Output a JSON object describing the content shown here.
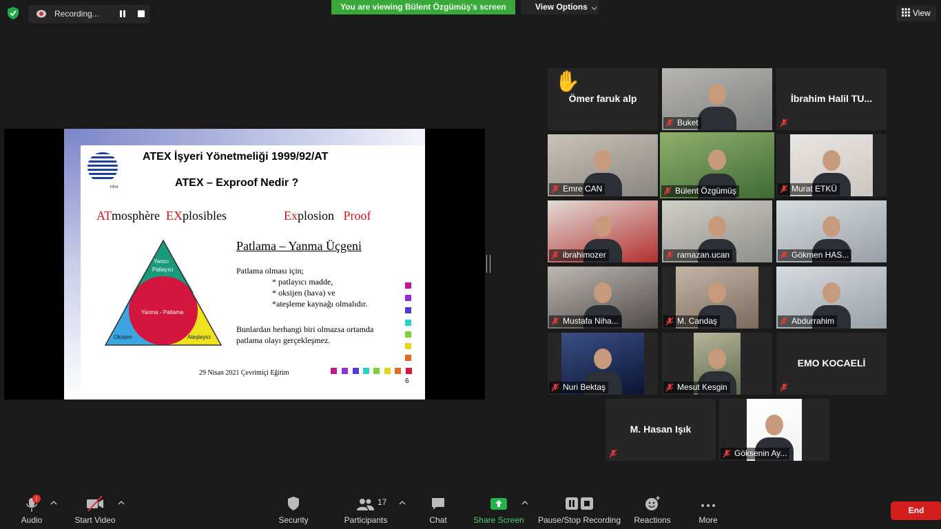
{
  "top": {
    "recording_label": "Recording...",
    "viewing_banner": "You are viewing Bülent Özgümüş's screen",
    "view_options": "View Options",
    "view": "View"
  },
  "slide": {
    "title1": "ATEX İşyeri Yönetmeliği 1999/92/AT",
    "title2": "ATEX – Exproof Nedir ?",
    "logo_year": "1954",
    "at_red": "AT",
    "at_rest": "mosphère",
    "ex_red": "EX",
    "ex_rest": "plosibles",
    "exp_red": "Ex",
    "exp_rest": "plosion",
    "proof": "Proof",
    "heading": "Patlama – Yanma Üçgeni",
    "line1": "Patlama olması için;",
    "line2": "* patlayıcı madde,",
    "line3": "* oksijen (hava) ve",
    "line4": "*ateşleme kaynağı olmalıdır.",
    "line5": "Bunlardan herhangi biri olmazsa ortamda",
    "line6": "patlama olayı gerçekleşmez.",
    "tri_top": "Yanıcı",
    "tri_top2": "Patlayıcı",
    "tri_center": "Yanma - Patlama",
    "tri_left": "Oksijen",
    "tri_right": "Ateşleyici",
    "footer": "29 Nisan 2021 Çevrimiçi Eğitim",
    "page": "6"
  },
  "participants": [
    {
      "name": "Ömer  faruk alp",
      "video": false,
      "hand": true
    },
    {
      "name": "Buket",
      "video": true
    },
    {
      "name": "İbrahim Halil  TU...",
      "video": false
    },
    {
      "name": "Emre CAN",
      "video": true
    },
    {
      "name": "Bülent Özgümüş",
      "video": true,
      "active": true
    },
    {
      "name": "Murat ETKÜ",
      "video": true
    },
    {
      "name": "ibrahimozer",
      "video": true
    },
    {
      "name": "ramazan.ucan",
      "video": true
    },
    {
      "name": "Gökmen HAS...",
      "video": true
    },
    {
      "name": "Mustafa Niha...",
      "video": true
    },
    {
      "name": "M. Candaş",
      "video": true
    },
    {
      "name": "Abdurrahim",
      "video": true
    },
    {
      "name": "Nuri Bektaş",
      "video": true
    },
    {
      "name": "Mesut Kesgin",
      "video": true
    },
    {
      "name": "EMO KOCAELİ",
      "video": false
    },
    {
      "name": "M. Hasan Işık",
      "video": false
    },
    {
      "name": "Göksenin Ay...",
      "video": true
    }
  ],
  "toolbar": {
    "audio": "Audio",
    "start_video": "Start Video",
    "security": "Security",
    "participants": "Participants",
    "participants_count": "17",
    "chat": "Chat",
    "share_screen": "Share Screen",
    "pause_stop": "Pause/Stop Recording",
    "reactions": "Reactions",
    "more": "More",
    "end": "End"
  },
  "colors": {
    "share_green": "#3aa83a",
    "end_red": "#d41f1f",
    "active_speaker": "#e8e56a",
    "mute_red": "#e03a3a"
  }
}
